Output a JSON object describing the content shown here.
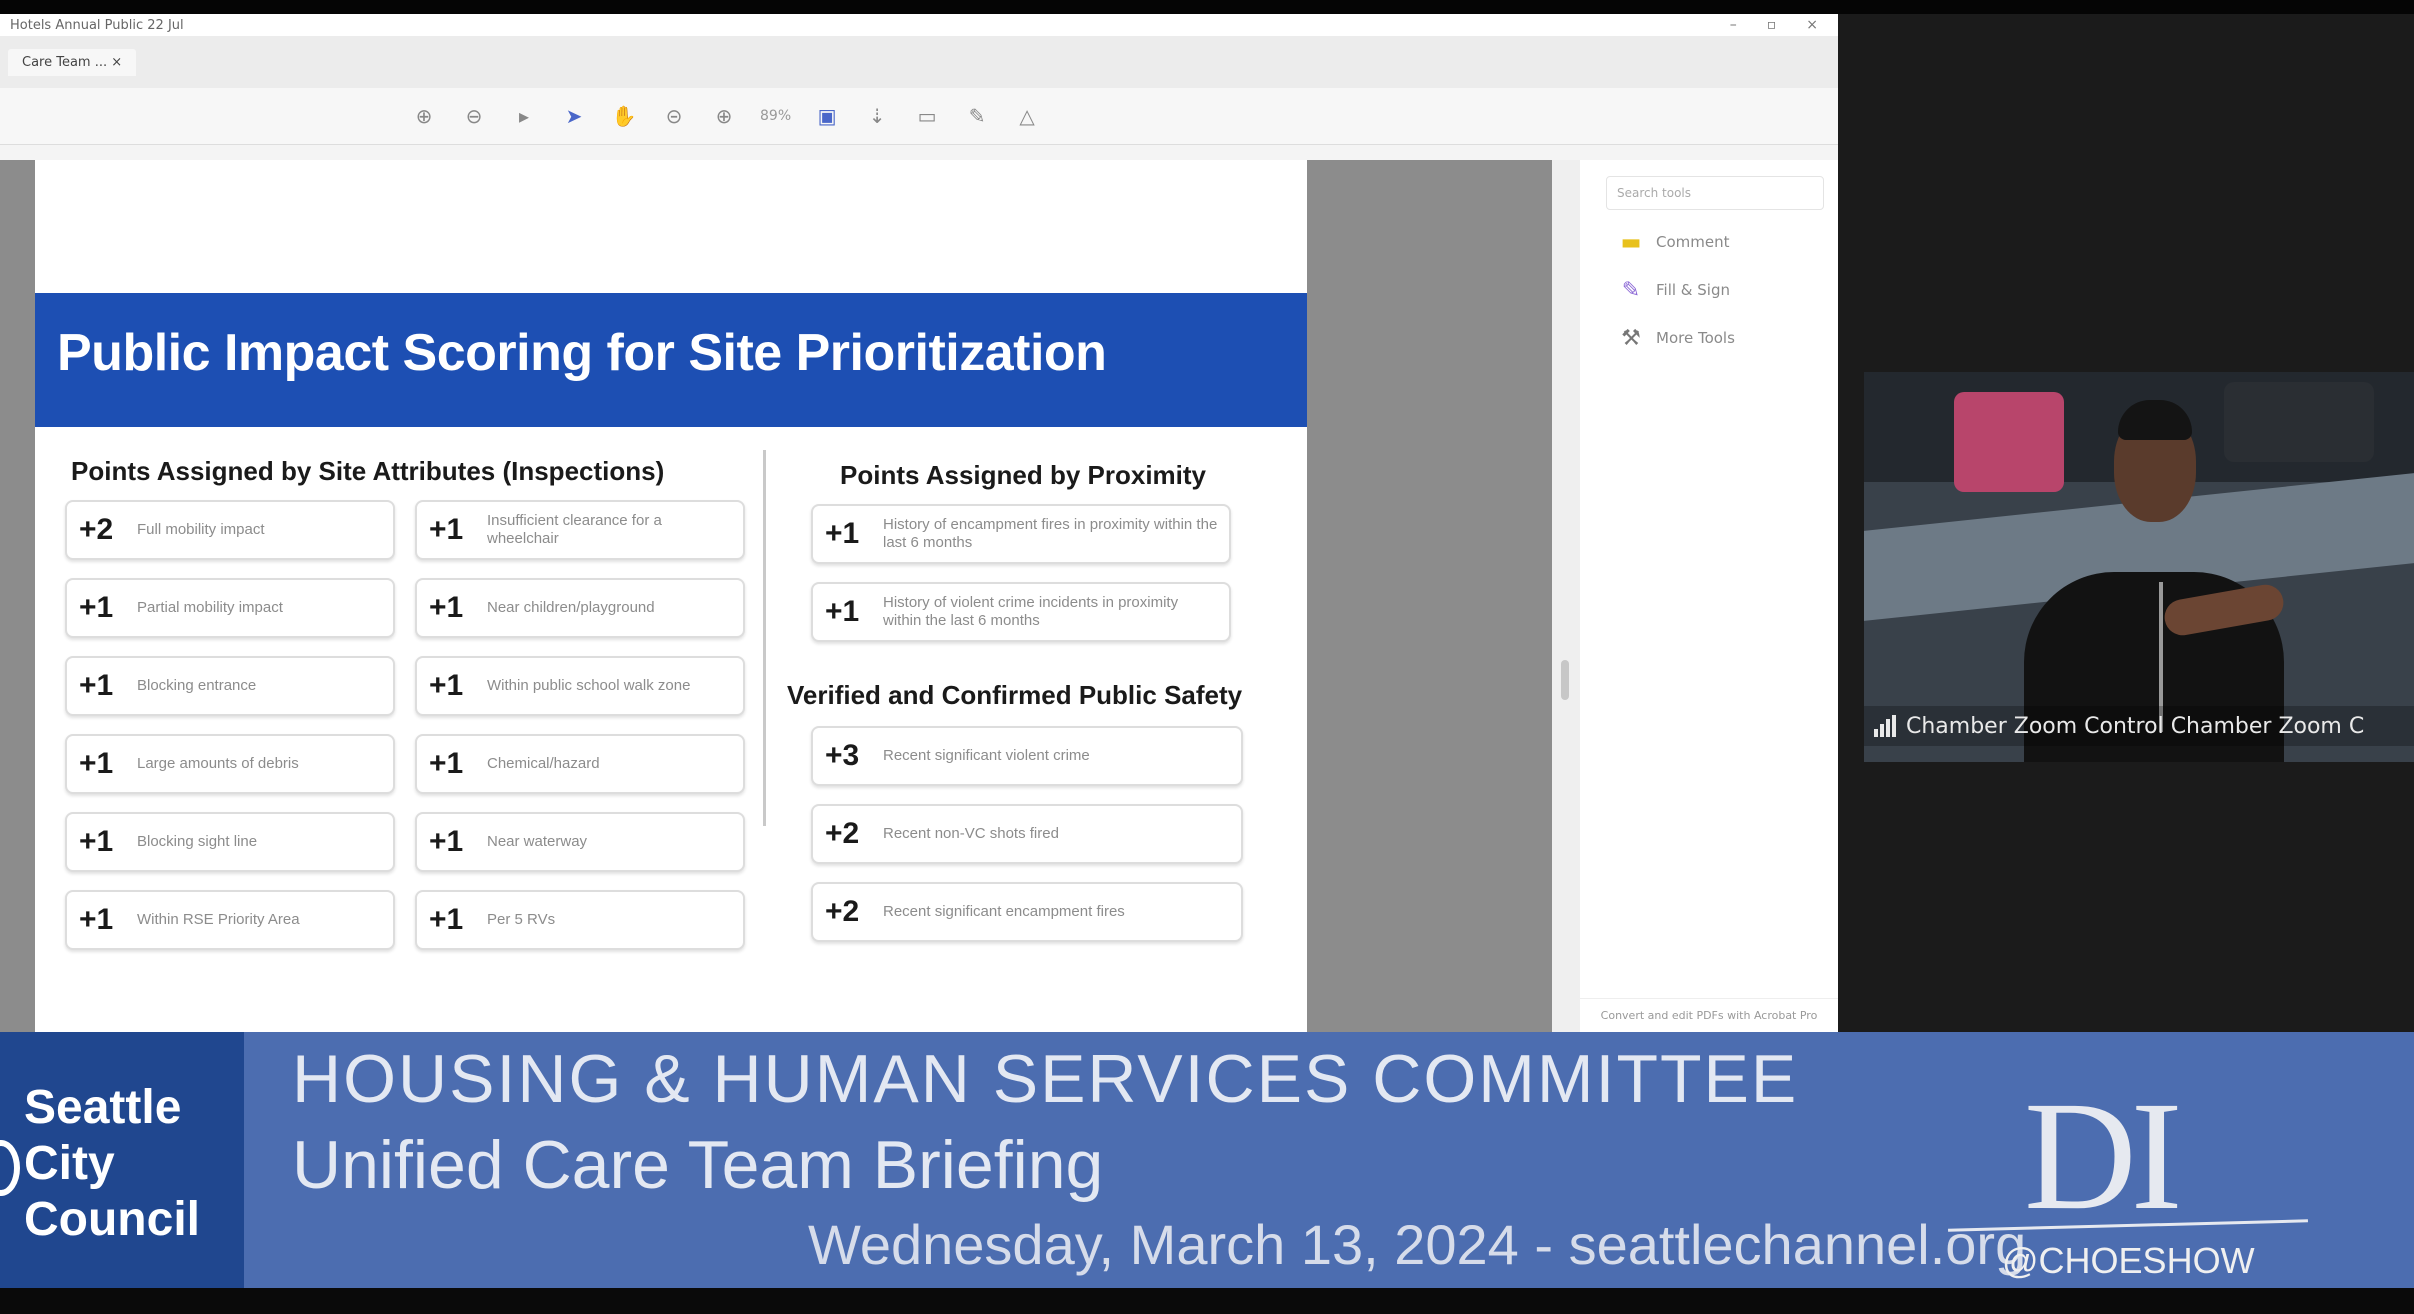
{
  "app": {
    "window_title": "Hotels Annual Public 22 Jul",
    "tab_label": "Care Team ...",
    "zoom": "89%",
    "search_placeholder": "Search tools",
    "tools": [
      {
        "label": "Comment",
        "icon": "comment-icon",
        "glyph": "▬"
      },
      {
        "label": "Fill & Sign",
        "icon": "fill-sign-icon",
        "glyph": "✎"
      },
      {
        "label": "More Tools",
        "icon": "more-tools-icon",
        "glyph": "⚒"
      }
    ],
    "footer": "Convert and edit PDFs with Acrobat Pro"
  },
  "slide": {
    "title": "Public Impact Scoring for Site Prioritization",
    "left_title": "Points Assigned by Site Attributes (Inspections)",
    "left_col1": [
      {
        "points": "+2",
        "label": "Full mobility impact"
      },
      {
        "points": "+1",
        "label": "Partial mobility impact"
      },
      {
        "points": "+1",
        "label": "Blocking entrance"
      },
      {
        "points": "+1",
        "label": "Large amounts of debris"
      },
      {
        "points": "+1",
        "label": "Blocking sight line"
      },
      {
        "points": "+1",
        "label": "Within RSE Priority Area"
      }
    ],
    "left_col2": [
      {
        "points": "+1",
        "label": "Insufficient clearance for a wheelchair"
      },
      {
        "points": "+1",
        "label": "Near children/playground"
      },
      {
        "points": "+1",
        "label": "Within public school walk zone"
      },
      {
        "points": "+1",
        "label": "Chemical/hazard"
      },
      {
        "points": "+1",
        "label": "Near waterway"
      },
      {
        "points": "+1",
        "label": "Per 5 RVs"
      }
    ],
    "proximity_title": "Points Assigned by Proximity",
    "proximity": [
      {
        "points": "+1",
        "label": "History of encampment fires in proximity within the last 6 months"
      },
      {
        "points": "+1",
        "label": "History of violent crime incidents in proximity within the last 6 months"
      }
    ],
    "safety_title": "Verified and Confirmed Public Safety",
    "safety": [
      {
        "points": "+3",
        "label": "Recent significant violent crime"
      },
      {
        "points": "+2",
        "label": "Recent non-VC shots fired"
      },
      {
        "points": "+2",
        "label": "Recent significant encampment fires"
      }
    ]
  },
  "camera": {
    "label": "Chamber Zoom Control Chamber Zoom C"
  },
  "lower_third": {
    "logo": "Seattle\nCity\nCouncil",
    "title": "HOUSING & HUMAN SERVICES COMMITTEE",
    "subtitle": "Unified Care Team Briefing",
    "date": "Wednesday, March 13, 2024 - seattlechannel.org",
    "watermark": "DI",
    "handle": "@CHOESHOW"
  }
}
